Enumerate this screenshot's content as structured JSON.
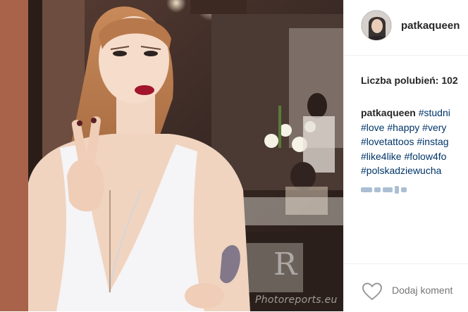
{
  "post": {
    "username": "patkaqueen",
    "likes_text": "Liczba polubień: 102",
    "caption_user": "patkaqueen",
    "caption_lines": [
      " #studni",
      "#love #happy #very",
      "#lovetattoos #instag",
      "#like4like #folow4fo",
      "#polskadziewucha"
    ],
    "comment_placeholder": "Dodaj koment",
    "watermark": "Photoreports.eu"
  },
  "colors": {
    "hashtag": "#003569",
    "text": "#262626",
    "muted": "#999999",
    "border": "#efefef"
  },
  "icons": {
    "like": "heart-outline-icon",
    "avatar": "profile-avatar"
  }
}
